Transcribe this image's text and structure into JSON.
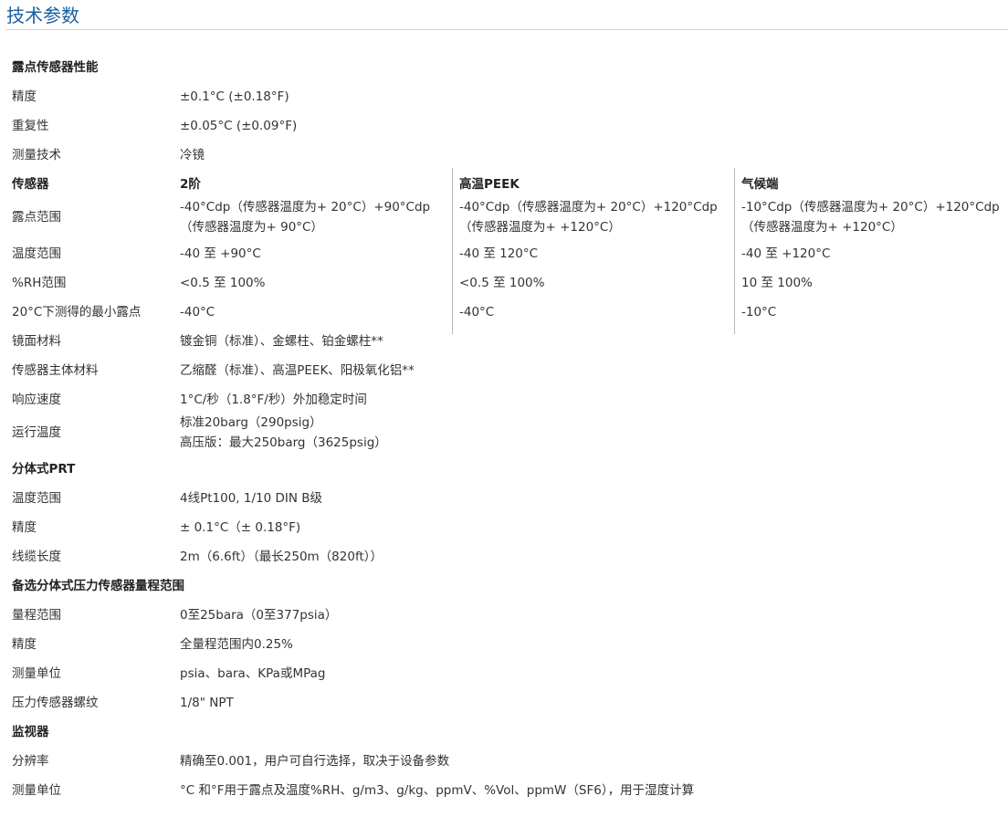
{
  "page_title": "技术参数",
  "sections": {
    "dewpoint_sensor": {
      "heading": "露点传感器性能",
      "accuracy": {
        "label": "精度",
        "value": "±0.1°C (±0.18°F)"
      },
      "repeatability": {
        "label": "重复性",
        "value": "±0.05°C (±0.09°F)"
      },
      "measurement_tech": {
        "label": "测量技术",
        "value": "冷镜"
      },
      "sensor_header": {
        "label": "传感器",
        "col1": "2阶",
        "col2": "高温PEEK",
        "col3": "气候端"
      },
      "dewpoint_range": {
        "label": "露点范围",
        "col1_line1": "-40°Cdp（传感器温度为+ 20°C）+90°Cdp",
        "col1_line2": "（传感器温度为+ 90°C）",
        "col2_line1": "-40°Cdp（传感器温度为+ 20°C）+120°Cdp",
        "col2_line2": "（传感器温度为+ +120°C）",
        "col3_line1": "-10°Cdp（传感器温度为+ 20°C）+120°Cdp",
        "col3_line2": "（传感器温度为+ +120°C）"
      },
      "temp_range": {
        "label": "温度范围",
        "col1": "-40 至 +90°C",
        "col2": "-40 至 120°C",
        "col3": "-40 至 +120°C"
      },
      "rh_range": {
        "label": "%RH范围",
        "col1": "<0.5 至 100%",
        "col2": "<0.5 至 100%",
        "col3": "10 至 100%"
      },
      "min_dewpoint": {
        "label": "20°C下测得的最小露点",
        "col1": "-40°C",
        "col2": "-40°C",
        "col3": "-10°C"
      },
      "mirror_material": {
        "label": "镜面材料",
        "value": "镀金铜（标准）、金螺柱、铂金螺柱**"
      },
      "body_material": {
        "label": "传感器主体材料",
        "value": "乙缩醛（标准）、高温PEEK、阳极氧化铝**"
      },
      "response_speed": {
        "label": "响应速度",
        "value": "1°C/秒（1.8°F/秒）外加稳定时间"
      },
      "operating_temp": {
        "label": "运行温度",
        "line1": "标准20barg（290psig）",
        "line2": "高压版：最大250barg（3625psig）"
      }
    },
    "prt": {
      "heading": "分体式PRT",
      "temp_range": {
        "label": "温度范围",
        "value": "4线Pt100, 1/10 DIN B级"
      },
      "accuracy": {
        "label": "精度",
        "value": "± 0.1°C（± 0.18°F)"
      },
      "cable_length": {
        "label": "线缆长度",
        "value": "2m（6.6ft）（最长250m（820ft））"
      }
    },
    "pressure": {
      "heading": "备选分体式压力传感器量程范围",
      "range": {
        "label": "量程范围",
        "value": "0至25bara（0至377psia）"
      },
      "accuracy": {
        "label": "精度",
        "value": "全量程范围内0.25%"
      },
      "units": {
        "label": "测量单位",
        "value": "psia、bara、KPa或MPag"
      },
      "thread": {
        "label": "压力传感器螺纹",
        "value": "1/8\" NPT"
      }
    },
    "monitor": {
      "heading": "监视器",
      "resolution": {
        "label": "分辨率",
        "value": "精确至0.001，用户可自行选择，取决于设备参数"
      },
      "units": {
        "label": "测量单位",
        "value": "°C 和°F用于露点及温度%RH、g/m3、g/kg、ppmV、%Vol、ppmW（SF6），用于湿度计算"
      }
    }
  },
  "colors": {
    "title": "#1a5fa0",
    "text": "#333333",
    "rule": "#d4d4d4"
  }
}
